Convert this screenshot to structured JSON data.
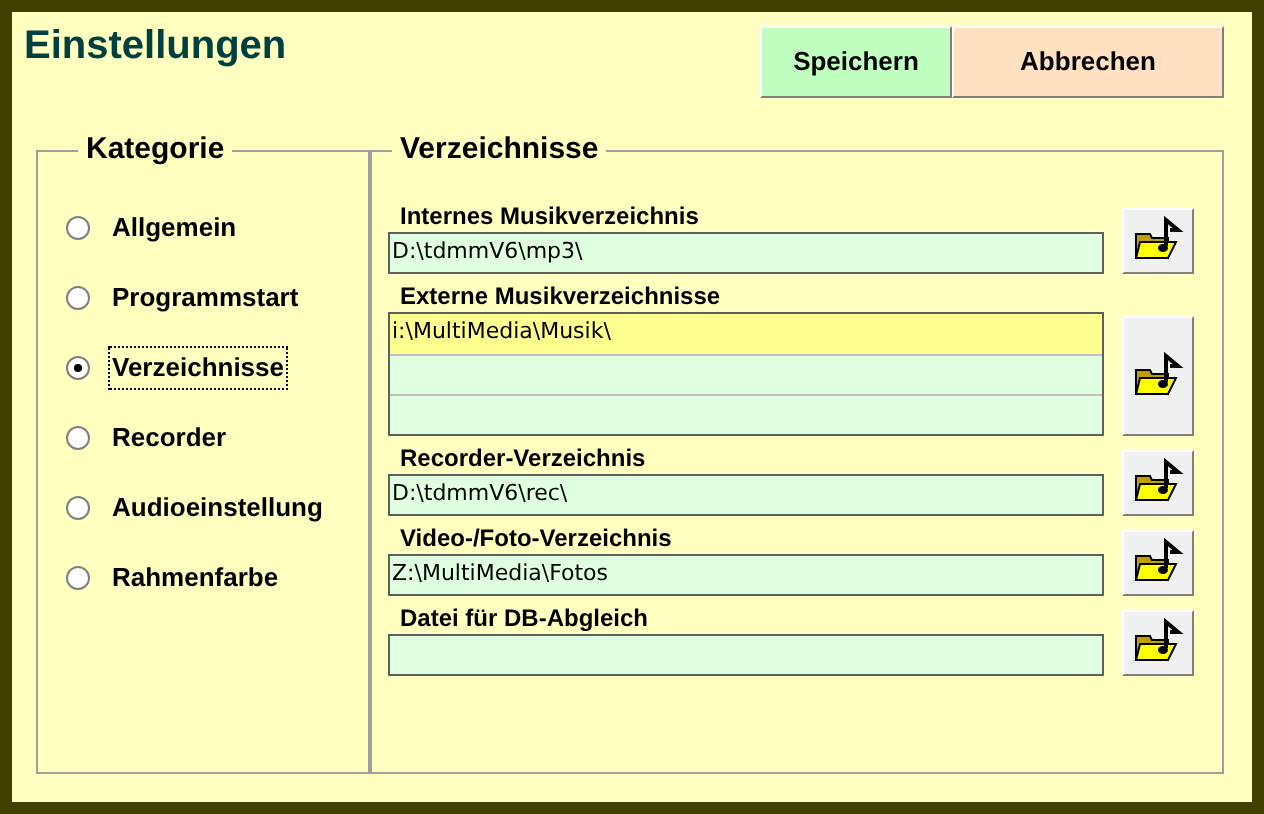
{
  "window": {
    "title": "Einstellungen"
  },
  "buttons": [
    {
      "label": "Speichern",
      "kind": "save"
    },
    {
      "label": "Abbrechen",
      "kind": "cancel"
    }
  ],
  "categories": {
    "title": "Kategorie",
    "items": [
      {
        "label": "Allgemein",
        "selected": false
      },
      {
        "label": "Programmstart",
        "selected": false
      },
      {
        "label": "Verzeichnisse",
        "selected": true
      },
      {
        "label": "Recorder",
        "selected": false
      },
      {
        "label": "Audioeinstellung",
        "selected": false
      },
      {
        "label": "Rahmenfarbe",
        "selected": false
      }
    ]
  },
  "directories": {
    "title": "Verzeichnisse",
    "items": [
      {
        "kind": "field",
        "label": "Internes Musikverzeichnis",
        "value": "D:\\tdmmV6\\mp3\\"
      },
      {
        "kind": "list",
        "label": "Externe Musikverzeichnisse",
        "rows": [
          {
            "value": "i:\\MultiMedia\\Musik\\",
            "selected": true
          },
          {
            "selected": false
          },
          {
            "selected": false
          }
        ]
      },
      {
        "kind": "field",
        "label": "Recorder-Verzeichnis",
        "value": "D:\\tdmmV6\\rec\\"
      },
      {
        "kind": "field",
        "label": "Video-/Foto-Verzeichnis",
        "value": "Z:\\MultiMedia\\Fotos"
      },
      {
        "kind": "field",
        "label": "Datei für DB-Abgleich"
      }
    ]
  }
}
